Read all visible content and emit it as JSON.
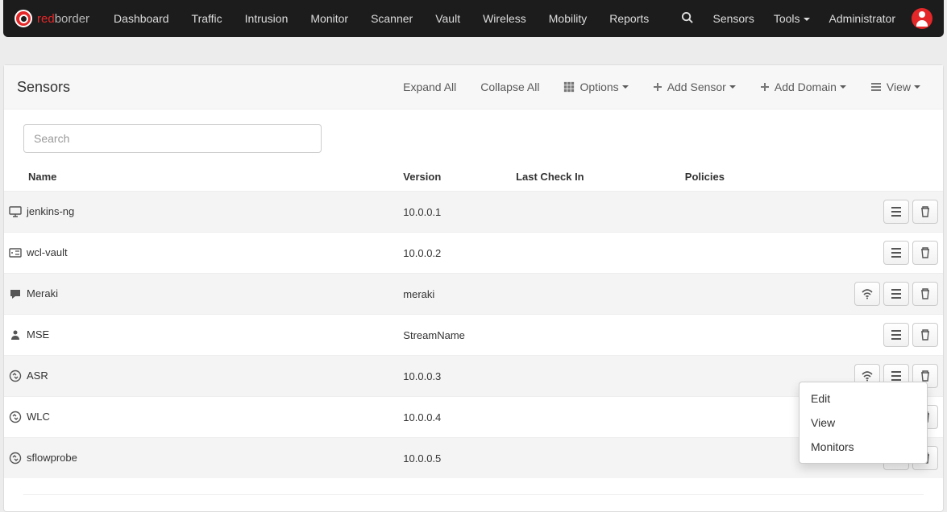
{
  "brand": {
    "red": "red",
    "border": "border"
  },
  "nav": {
    "items": [
      "Dashboard",
      "Traffic",
      "Intrusion",
      "Monitor",
      "Scanner",
      "Vault",
      "Wireless",
      "Mobility",
      "Reports"
    ],
    "right": {
      "sensors": "Sensors",
      "tools": "Tools",
      "admin": "Administrator"
    }
  },
  "page": {
    "title": "Sensors",
    "actions": {
      "expand": "Expand All",
      "collapse": "Collapse All",
      "options": "Options",
      "add_sensor": "Add Sensor",
      "add_domain": "Add Domain",
      "view": "View"
    }
  },
  "search": {
    "placeholder": "Search"
  },
  "columns": {
    "name": "Name",
    "version": "Version",
    "last_check_in": "Last Check In",
    "policies": "Policies"
  },
  "rows": [
    {
      "name": "jenkins-ng",
      "version": "10.0.0.1",
      "icon": "monitor",
      "wifi": false,
      "highlight": true
    },
    {
      "name": "wcl-vault",
      "version": "10.0.0.2",
      "icon": "server",
      "wifi": false,
      "highlight": false
    },
    {
      "name": "Meraki",
      "version": "meraki",
      "icon": "chat",
      "wifi": true,
      "highlight": true
    },
    {
      "name": "MSE",
      "version": "StreamName",
      "icon": "person",
      "wifi": false,
      "highlight": false
    },
    {
      "name": "ASR",
      "version": "10.0.0.3",
      "icon": "swap",
      "wifi": true,
      "highlight": true
    },
    {
      "name": "WLC",
      "version": "10.0.0.4",
      "icon": "swap",
      "wifi": false,
      "highlight": false
    },
    {
      "name": "sflowprobe",
      "version": "10.0.0.5",
      "icon": "swap",
      "wifi": false,
      "highlight": true
    }
  ],
  "row_dropdown": {
    "edit": "Edit",
    "view": "View",
    "monitors": "Monitors"
  }
}
